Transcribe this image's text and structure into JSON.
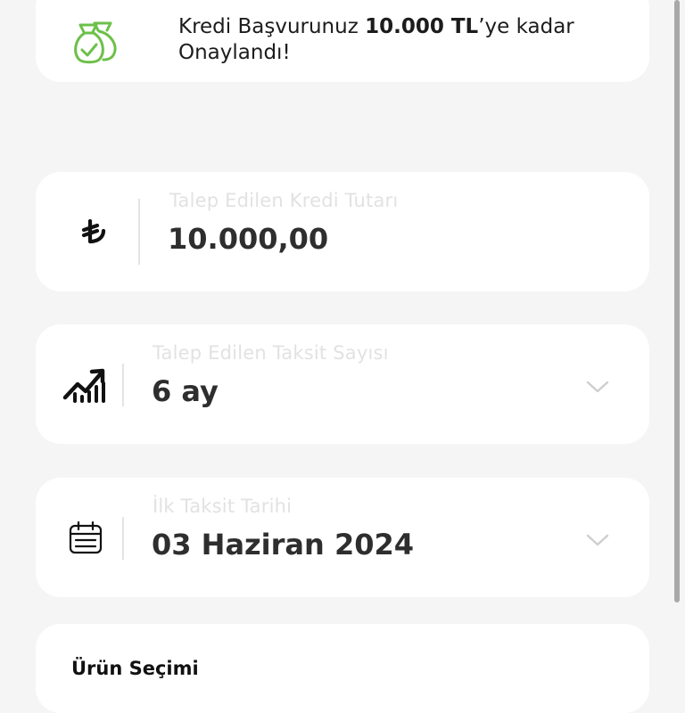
{
  "banner": {
    "text_prefix": "Kredi Başvurunuz ",
    "amount": "10.000 TL",
    "text_suffix": "’ye kadar Onaylandı!",
    "icon": "money-bags-check-icon",
    "icon_color": "#6cc04a"
  },
  "fields": {
    "amount": {
      "label": "Talep Edilen Kredi Tutarı",
      "value": "10.000,00",
      "icon": "turkish-lira-icon"
    },
    "installments": {
      "label": "Talep Edilen Taksit Sayısı",
      "value": "6 ay",
      "icon": "trending-up-chart-icon"
    },
    "first_date": {
      "label": "İlk Taksit Tarihi",
      "value": "03 Haziran 2024",
      "icon": "calendar-icon"
    }
  },
  "product": {
    "title": "Ürün Seçimi"
  },
  "colors": {
    "background": "#f5f5f5",
    "card": "#ffffff",
    "accent_green": "#6cc04a",
    "label_gray": "#e2e2e2"
  }
}
